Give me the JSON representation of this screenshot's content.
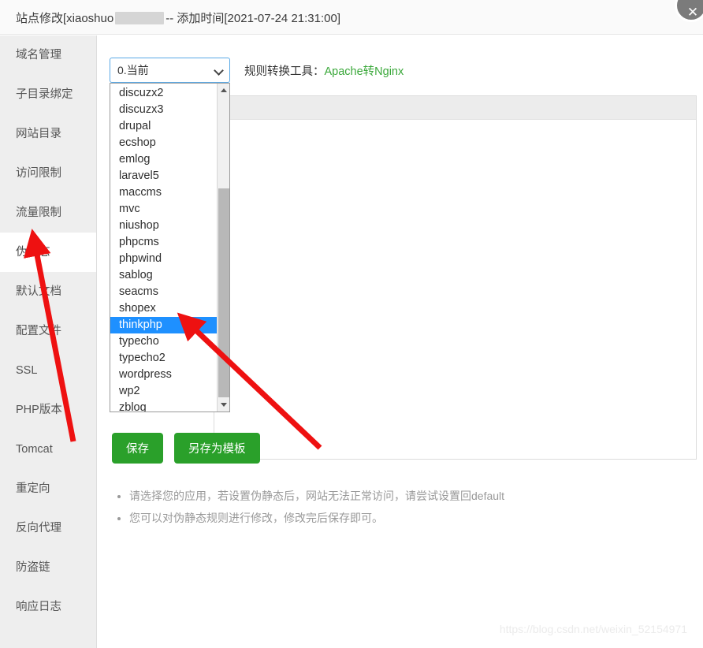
{
  "window": {
    "title_prefix": "站点修改[xiaoshuo",
    "title_suffix": "-- 添加时间[2021-07-24 21:31:00]",
    "close_label": "✕"
  },
  "sidebar": {
    "items": [
      {
        "label": "域名管理",
        "active": false
      },
      {
        "label": "子目录绑定",
        "active": false
      },
      {
        "label": "网站目录",
        "active": false
      },
      {
        "label": "访问限制",
        "active": false
      },
      {
        "label": "流量限制",
        "active": false
      },
      {
        "label": "伪静态",
        "active": true
      },
      {
        "label": "默认文档",
        "active": false
      },
      {
        "label": "配置文件",
        "active": false
      },
      {
        "label": "SSL",
        "active": false
      },
      {
        "label": "PHP版本",
        "active": false
      },
      {
        "label": "Tomcat",
        "active": false
      },
      {
        "label": "重定向",
        "active": false
      },
      {
        "label": "反向代理",
        "active": false
      },
      {
        "label": "防盗链",
        "active": false
      },
      {
        "label": "响应日志",
        "active": false
      }
    ]
  },
  "toolbar": {
    "select_value": "0.当前",
    "convert_label": "规则转换工具：",
    "convert_link": "Apache转Nginx"
  },
  "dropdown": {
    "options": [
      "discuzx2",
      "discuzx3",
      "drupal",
      "ecshop",
      "emlog",
      "laravel5",
      "maccms",
      "mvc",
      "niushop",
      "phpcms",
      "phpwind",
      "sablog",
      "seacms",
      "shopex",
      "thinkphp",
      "typecho",
      "typecho2",
      "wordpress",
      "wp2",
      "zblog"
    ],
    "selected": "thinkphp"
  },
  "buttons": {
    "save": "保存",
    "save_as_template": "另存为模板"
  },
  "notes": [
    "请选择您的应用，若设置伪静态后，网站无法正常访问，请尝试设置回default",
    "您可以对伪静态规则进行修改，修改完后保存即可。"
  ],
  "watermark": "https://blog.csdn.net/weixin_52154971",
  "colors": {
    "accent_green": "#2aa02a",
    "link_green": "#3aa83a",
    "selection_blue": "#1e90ff",
    "annotation_red": "#ee1111",
    "sidebar_bg": "#eeeeee"
  }
}
